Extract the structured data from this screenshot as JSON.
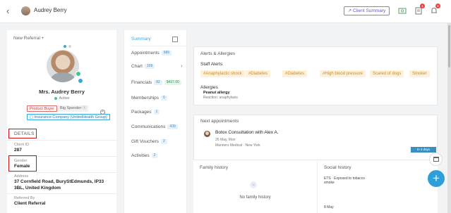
{
  "header": {
    "back_icon": "chevron-left-icon",
    "client_name": "Audrey Berry",
    "client_summary_label": "Client Summary",
    "icons": [
      {
        "name": "money-icon",
        "badge": ""
      },
      {
        "name": "inbox-icon",
        "badge": "1"
      },
      {
        "name": "bell-icon",
        "badge": "0"
      }
    ]
  },
  "profile": {
    "new_referral": "New Referral +",
    "name": "Mrs. Audrey Berry",
    "status": "Active",
    "tags": [
      "Product Buyer",
      "Big Spender",
      "Insurance Company (UnitedHealth Group)"
    ],
    "details_heading": "DETAILS",
    "fields": [
      {
        "label": "Client ID",
        "value": "287"
      },
      {
        "label": "Gender",
        "value": "Female"
      },
      {
        "label": "Address",
        "value": "37 Cornfield Road, BuryStEdmunds, IP33 3BL, United Kingdom"
      },
      {
        "label": "Referred By",
        "value": "Client Referral"
      }
    ]
  },
  "nav": [
    {
      "label": "Summary",
      "badge": ""
    },
    {
      "label": "Appointments",
      "badge": "689"
    },
    {
      "label": "Chart",
      "badge": "109"
    },
    {
      "label": "Financials",
      "badge": "82",
      "amount": "$437.00"
    },
    {
      "label": "Memberships",
      "badge": "0"
    },
    {
      "label": "Packages",
      "badge": "1"
    },
    {
      "label": "Communications",
      "badge": "439"
    },
    {
      "label": "Gift Vouchers",
      "badge": "2"
    },
    {
      "label": "Activities",
      "badge": "2"
    }
  ],
  "alerts": {
    "title": "Alerts & Allergies",
    "staff_alerts_label": "Staff Alerts",
    "staff_alerts": [
      "#Anaphylactic shock",
      "#Diabetes",
      "#Diabetes",
      "#High blood pressure",
      "Scared of dogs",
      "Smoker"
    ],
    "allergies_label": "Allergies",
    "allergy_name": "Peanut allergy",
    "allergy_reaction": "Reaction: anaphylaxis"
  },
  "next_appointments": {
    "title": "Next appointments",
    "appt_title": "Botox Consultation with Alex A.",
    "date": "26 May, Mon",
    "location": "Manners Medical · New York",
    "badge": "In 3 days"
  },
  "family_history": {
    "title": "Family history",
    "empty": "No family history",
    "empty_icon": "family-icon"
  },
  "social_history": {
    "title": "Social history",
    "entry1": "ETS · Exposed to tobacco smoke",
    "entry2": "8 May"
  },
  "fab": {
    "calendar_icon": "calendar-icon",
    "add_icon": "plus-icon",
    "add_label": "+"
  },
  "colors": {
    "accent": "#3aa6dc",
    "highlight": "#d01010",
    "alert_chip": "#fdf1dc"
  }
}
